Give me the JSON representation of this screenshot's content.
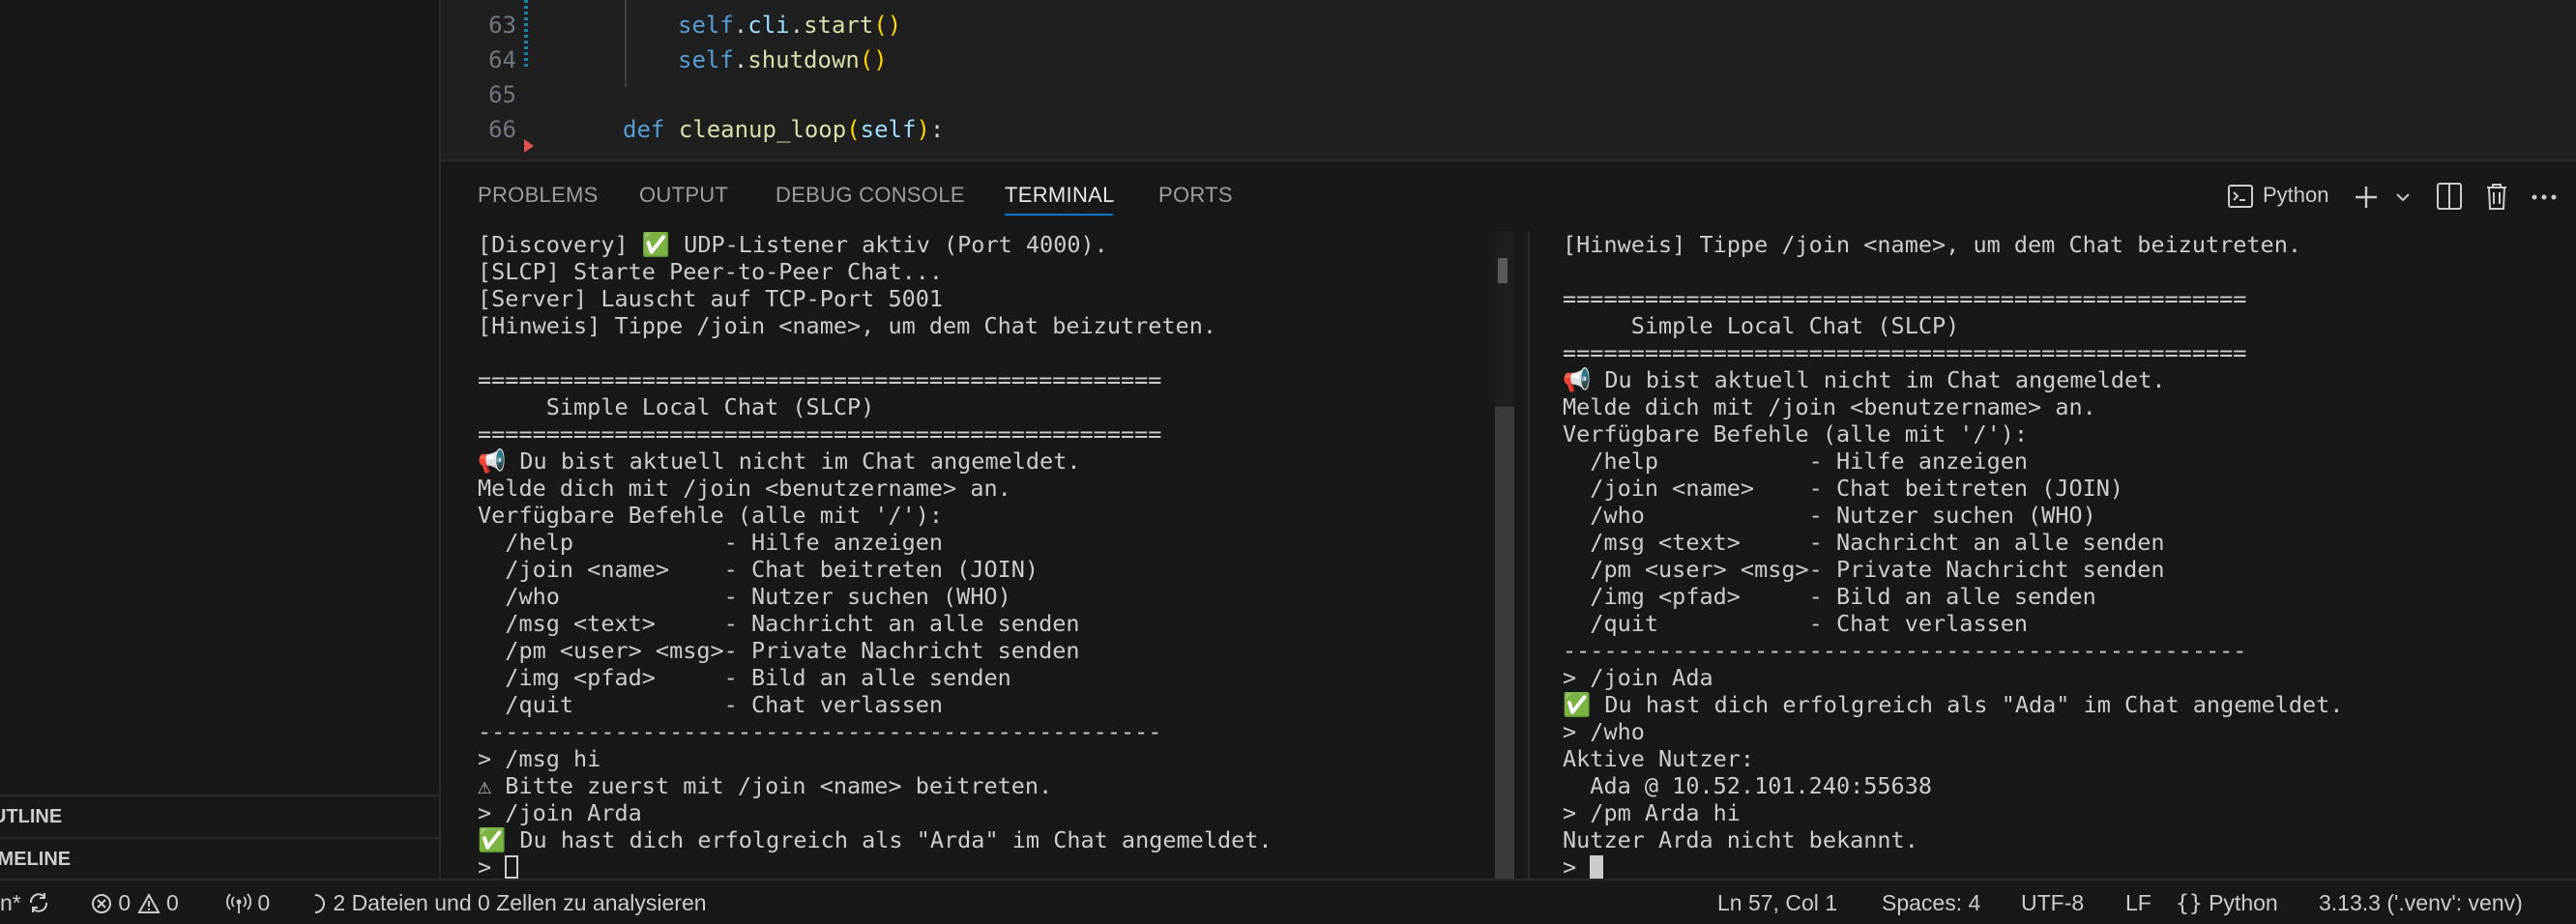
{
  "sidebar": {
    "outline_label": "UTLINE",
    "timeline_label": "IMELINE"
  },
  "editor": {
    "lines": [
      {
        "num": "63",
        "indent": "        ",
        "tokens": [
          [
            "self",
            "self"
          ],
          [
            ".",
            " "
          ],
          [
            "cli",
            "attr"
          ],
          [
            ".",
            ""
          ],
          [
            "start",
            "fn"
          ],
          [
            "()",
            "p"
          ]
        ]
      },
      {
        "num": "64"
      },
      {
        "num": "65"
      },
      {
        "num": "66"
      }
    ],
    "line63": {
      "num": "63",
      "self": "self",
      "dot1": ".",
      "attr": "cli",
      "dot2": ".",
      "fn": "start",
      "paren": "()"
    },
    "line64": {
      "num": "64",
      "self": "self",
      "dot1": ".",
      "fn": "shutdown",
      "paren": "()"
    },
    "line65": {
      "num": "65"
    },
    "line66": {
      "num": "66",
      "kw": "def",
      "fn": "cleanup_loop",
      "open": "(",
      "arg": "self",
      "close": ")",
      "colon": ":"
    }
  },
  "panel": {
    "tabs": [
      "PROBLEMS",
      "OUTPUT",
      "DEBUG CONSOLE",
      "TERMINAL",
      "PORTS"
    ],
    "active_tab": "TERMINAL",
    "shell_label": "Python",
    "icons": [
      "terminal-icon",
      "plus-icon",
      "chevron-down-icon",
      "split-icon",
      "trash-icon",
      "more-icon"
    ]
  },
  "terminal_left": {
    "lines": [
      "[Discovery] ✅ UDP-Listener aktiv (Port 4000).",
      "[SLCP] Starte Peer-to-Peer Chat...",
      "[Server] Lauscht auf TCP-Port 5001",
      "[Hinweis] Tippe /join <name>, um dem Chat beizutreten.",
      "",
      "==================================================",
      "     Simple Local Chat (SLCP)",
      "==================================================",
      "📢 Du bist aktuell nicht im Chat angemeldet.",
      "Melde dich mit /join <benutzername> an.",
      "Verfügbare Befehle (alle mit '/'):",
      "  /help           - Hilfe anzeigen",
      "  /join <name>    - Chat beitreten (JOIN)",
      "  /who            - Nutzer suchen (WHO)",
      "  /msg <text>     - Nachricht an alle senden",
      "  /pm <user> <msg>- Private Nachricht senden",
      "  /img <pfad>     - Bild an alle senden",
      "  /quit           - Chat verlassen",
      "--------------------------------------------------",
      "> /msg hi",
      "⚠ Bitte zuerst mit /join <name> beitreten.",
      "> /join Arda",
      "✅ Du hast dich erfolgreich als \"Arda\" im Chat angemeldet."
    ],
    "prompt": "> "
  },
  "terminal_right": {
    "lines": [
      "[Hinweis] Tippe /join <name>, um dem Chat beizutreten.",
      "",
      "==================================================",
      "     Simple Local Chat (SLCP)",
      "==================================================",
      "📢 Du bist aktuell nicht im Chat angemeldet.",
      "Melde dich mit /join <benutzername> an.",
      "Verfügbare Befehle (alle mit '/'):",
      "  /help           - Hilfe anzeigen",
      "  /join <name>    - Chat beitreten (JOIN)",
      "  /who            - Nutzer suchen (WHO)",
      "  /msg <text>     - Nachricht an alle senden",
      "  /pm <user> <msg>- Private Nachricht senden",
      "  /img <pfad>     - Bild an alle senden",
      "  /quit           - Chat verlassen",
      "--------------------------------------------------",
      "> /join Ada",
      "✅ Du hast dich erfolgreich als \"Ada\" im Chat angemeldet.",
      "> /who",
      "Aktive Nutzer:",
      "  Ada @ 10.52.101.240:55638",
      "> /pm Arda hi",
      "Nutzer Arda nicht bekannt."
    ],
    "prompt": "> "
  },
  "statusbar": {
    "branch": "n*",
    "errors": "0",
    "warnings": "0",
    "ports": "0",
    "analysis": "2 Dateien und 0 Zellen zu analysieren",
    "position": "Ln 57, Col 1",
    "spaces": "Spaces: 4",
    "encoding": "UTF-8",
    "eol": "LF",
    "language": "Python",
    "interpreter": "3.13.3 ('.venv': venv)",
    "colors": {
      "accent": "#0078d4",
      "background": "#181818",
      "editor_bg": "#1f1f1f"
    }
  }
}
